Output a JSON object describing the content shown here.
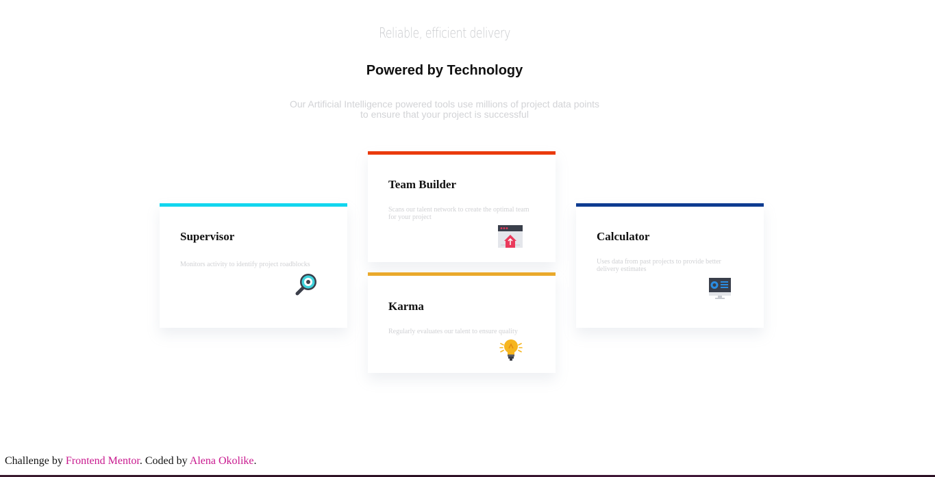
{
  "hero": {
    "eyebrow": "Reliable, efficient delivery",
    "title": "Powered by Technology",
    "subtitle": "Our Artificial Intelligence powered tools use millions of project data points to ensure that your project is successful"
  },
  "cards": {
    "supervisor": {
      "title": "Supervisor",
      "description": "Monitors activity to identify project roadblocks",
      "accent": "#12d6ef",
      "icon": "magnifier-icon"
    },
    "team_builder": {
      "title": "Team Builder",
      "description": "Scans our talent network to create the optimal team for your project",
      "accent": "#ea3a0c",
      "icon": "upload-window-icon"
    },
    "karma": {
      "title": "Karma",
      "description": "Regularly evaluates our talent to ensure quality",
      "accent": "#eaa92b",
      "icon": "lightbulb-icon"
    },
    "calculator": {
      "title": "Calculator",
      "description": "Uses data from past projects to provide better delivery estimates",
      "accent": "#0e3c91",
      "icon": "monitor-chart-icon"
    }
  },
  "footer": {
    "prefix": "Challenge by ",
    "link1": "Frontend Mentor",
    "middle": ". Coded by ",
    "link2": "Alena Okolike",
    "suffix": "."
  }
}
